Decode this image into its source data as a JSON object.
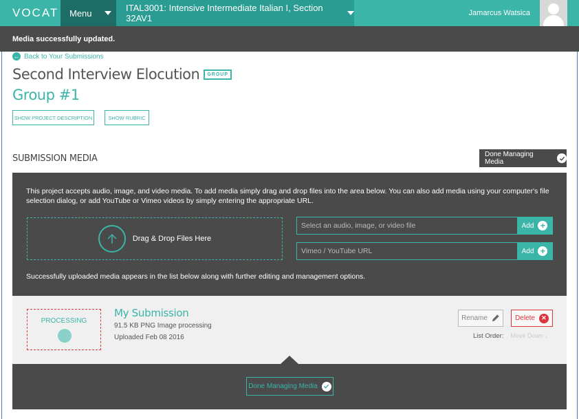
{
  "app": {
    "logo": "VOCAT",
    "menu_label": "Menu",
    "course_label": "ITAL3001: Intensive Intermediate Italian I, Section 32AV1",
    "user_name": "Jamarcus Watsica"
  },
  "flash": {
    "message": "Media successfully updated."
  },
  "back_link": "Back to Your Submissions",
  "project": {
    "title": "Second Interview Elocution",
    "badge": "GROUP",
    "group_name": "Group #1",
    "show_description_label": "SHOW PROJECT DESCRIPTION",
    "show_rubric_label": "SHOW RUBRIC"
  },
  "submission_media": {
    "heading": "SUBMISSION MEDIA",
    "done_label": "Done Managing Media",
    "instructions": "This project accepts audio, image, and video media. To add media simply drag and drop files into the area below. You can also add media using your computer's file selection dialog, or add YouTube or Vimeo videos by simply entering the appropriate URL.",
    "dropzone_label": "Drag & Drop Files Here",
    "file_input_placeholder": "Select an audio, image, or video file",
    "url_input_placeholder": "Vimeo / YouTube URL",
    "add_label": "Add",
    "footer_note": "Successfully uploaded media appears in the list below along with further editing and management options."
  },
  "media_item": {
    "status": "PROCESSING",
    "title": "My Submission",
    "meta": "91.5 KB PNG Image processing",
    "uploaded": "Uploaded Feb 08 2016",
    "rename_label": "Rename",
    "delete_label": "Delete",
    "list_order_label": "List Order:",
    "move_down_label": "Move Down"
  },
  "colors": {
    "accent": "#3ab5a8",
    "dark": "#4a4a4a",
    "danger": "#d9363e"
  }
}
